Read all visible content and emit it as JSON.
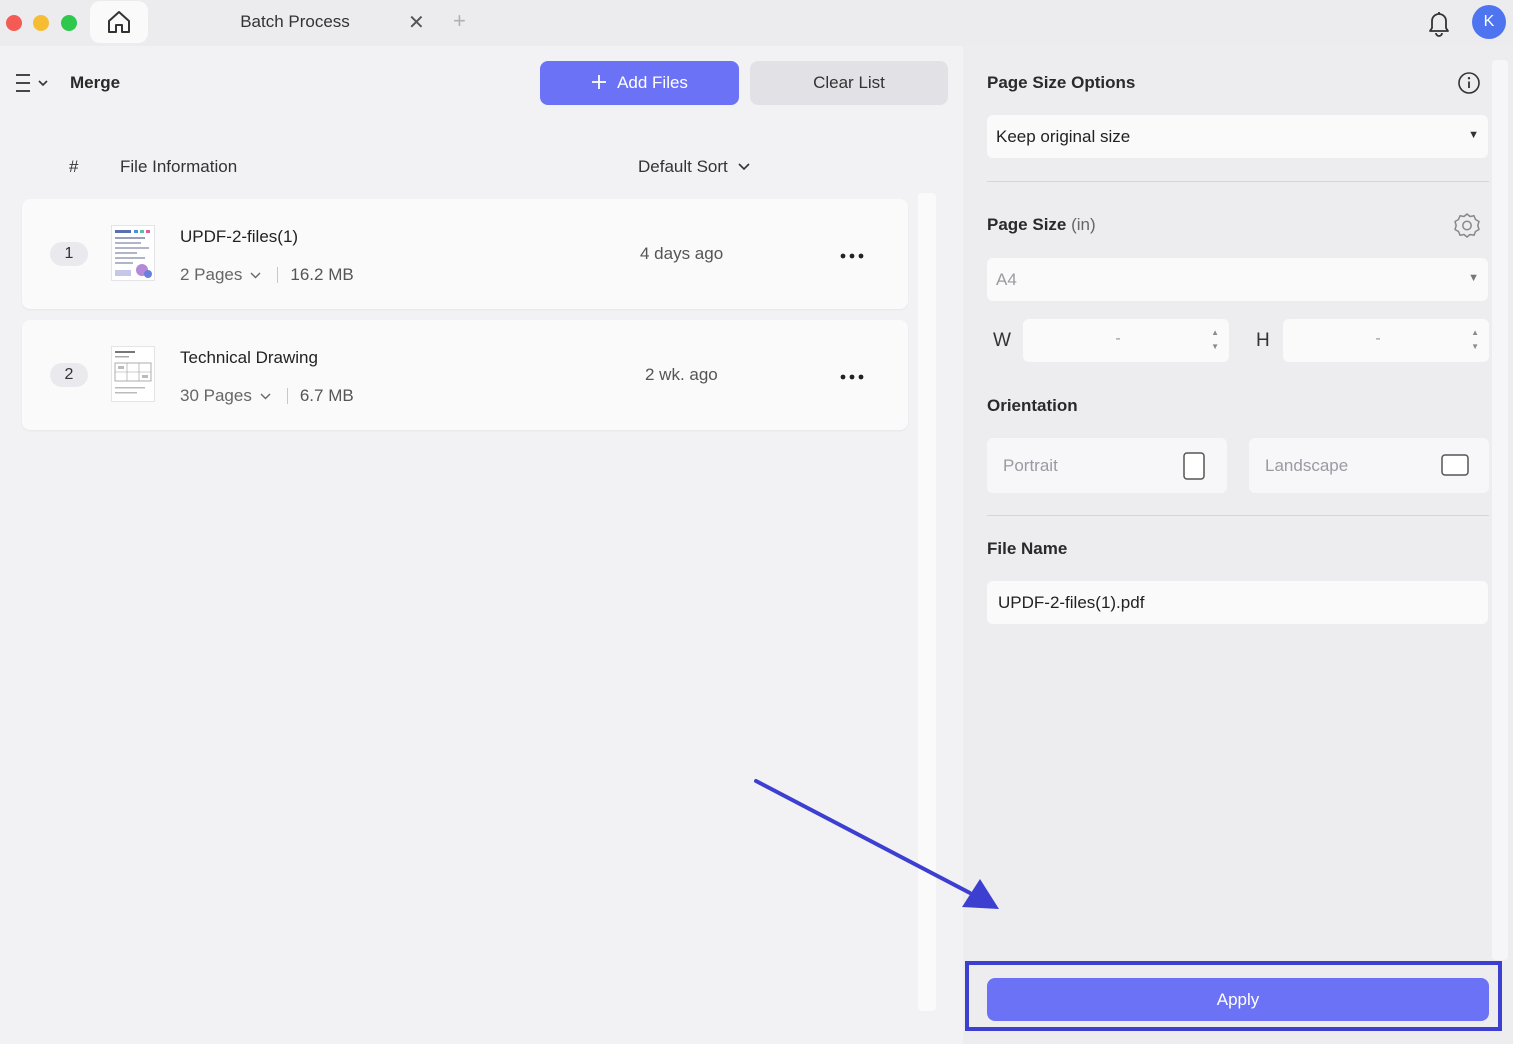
{
  "titlebar": {
    "tab_title": "Batch Process",
    "close_glyph": "✕",
    "new_tab_glyph": "+",
    "avatar_initial": "K"
  },
  "toolbar": {
    "heading": "Merge",
    "add_files_label": "Add Files",
    "clear_list_label": "Clear List"
  },
  "file_list": {
    "col_number": "#",
    "col_info": "File Information",
    "sort_label": "Default Sort",
    "rows": [
      {
        "index": "1",
        "name": "UPDF-2-files(1)",
        "pages": "2 Pages",
        "size": "16.2 MB",
        "date": "4 days ago"
      },
      {
        "index": "2",
        "name": "Technical Drawing",
        "pages": "30 Pages",
        "size": "6.7 MB",
        "date": "2 wk. ago"
      }
    ]
  },
  "options": {
    "page_size_options_label": "Page Size Options",
    "page_size_option_value": "Keep original size",
    "page_size_label": "Page Size",
    "page_size_unit": "(in)",
    "page_size_value": "A4",
    "width_label": "W",
    "width_value": "-",
    "height_label": "H",
    "height_value": "-",
    "orientation_label": "Orientation",
    "portrait_label": "Portrait",
    "landscape_label": "Landscape",
    "file_name_label": "File Name",
    "file_name_value": "UPDF-2-files(1).pdf",
    "apply_label": "Apply"
  },
  "colors": {
    "accent": "#6b72f6",
    "highlight_box": "#3d3fd1",
    "avatar": "#4e74f0"
  }
}
